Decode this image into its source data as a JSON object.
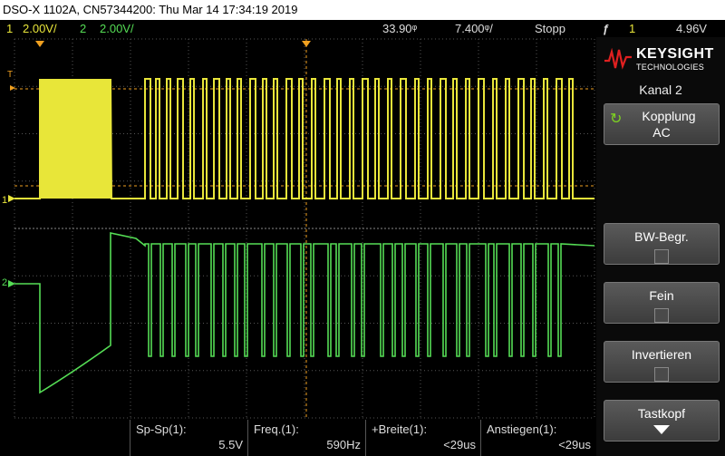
{
  "title": "DSO-X 1102A, CN57344200: Thu Mar 14 17:34:19 2019",
  "status": {
    "ch1_num": "1",
    "ch1_scale": "2.00V/",
    "ch2_num": "2",
    "ch2_scale": "2.00V/",
    "time_offset": "33.90ᵠ",
    "time_scale": "7.400ᵠ/",
    "run_state": "Stopp",
    "trigger_icon": "ƒ",
    "trig_ch": "1",
    "trig_level": "4.96V"
  },
  "sidebar": {
    "brand": "KEYSIGHT",
    "brand_sub": "TECHNOLOGIES",
    "channel_title": "Kanal 2",
    "softkeys": [
      {
        "label": "Kopplung",
        "value": "AC"
      },
      {
        "label": "BW-Begr."
      },
      {
        "label": "Fein"
      },
      {
        "label": "Invertieren"
      },
      {
        "label": "Tastkopf"
      }
    ]
  },
  "measurements": [
    {
      "name": "Sp-Sp(1):",
      "value": "5.5V"
    },
    {
      "name": "Freq.(1):",
      "value": "590Hz"
    },
    {
      "name": "+Breite(1):",
      "value": "<29us"
    },
    {
      "name": "Anstiegen(1):",
      "value": "<29us"
    }
  ],
  "markers": {
    "ch1": "1",
    "ch2": "2",
    "trig": "T"
  },
  "colors": {
    "ch1": "#e8e53a",
    "ch2": "#55dd55",
    "trigger": "#f0a020",
    "grid": "#555555"
  }
}
